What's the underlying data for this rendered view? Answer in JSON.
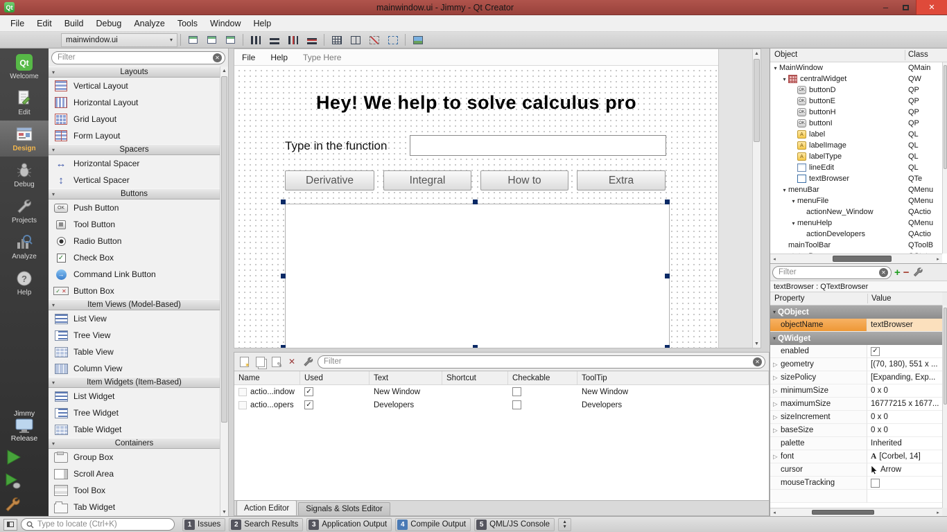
{
  "colors": {
    "titlebar": "#a2453f",
    "close_button": "#df4a3a",
    "selection_orange": "#ee9835",
    "run_green": "#47a33b",
    "accent_blue": "#3a6ea5",
    "handle_navy": "#0a2a66"
  },
  "titlebar": {
    "title": "mainwindow.ui - Jimmy - Qt Creator",
    "app_logo": "Qt"
  },
  "menubar": {
    "items": [
      "File",
      "Edit",
      "Build",
      "Debug",
      "Analyze",
      "Tools",
      "Window",
      "Help"
    ]
  },
  "toolbar": {
    "document": "mainwindow.ui"
  },
  "modebar": {
    "modes": [
      {
        "label": "Welcome"
      },
      {
        "label": "Edit"
      },
      {
        "label": "Design"
      },
      {
        "label": "Debug"
      },
      {
        "label": "Projects"
      },
      {
        "label": "Analyze"
      },
      {
        "label": "Help"
      }
    ],
    "kit": "Jimmy",
    "build_config": "Release"
  },
  "widget_box": {
    "filter_placeholder": "Filter",
    "categories": [
      {
        "name": "Layouts",
        "items": [
          "Vertical Layout",
          "Horizontal Layout",
          "Grid Layout",
          "Form Layout"
        ]
      },
      {
        "name": "Spacers",
        "items": [
          "Horizontal Spacer",
          "Vertical Spacer"
        ]
      },
      {
        "name": "Buttons",
        "items": [
          "Push Button",
          "Tool Button",
          "Radio Button",
          "Check Box",
          "Command Link Button",
          "Button Box"
        ]
      },
      {
        "name": "Item Views (Model-Based)",
        "items": [
          "List View",
          "Tree View",
          "Table View",
          "Column View"
        ]
      },
      {
        "name": "Item Widgets (Item-Based)",
        "items": [
          "List Widget",
          "Tree Widget",
          "Table Widget"
        ]
      },
      {
        "name": "Containers",
        "items": [
          "Group Box",
          "Scroll Area",
          "Tool Box",
          "Tab Widget"
        ]
      }
    ]
  },
  "form": {
    "menu_items": [
      "File",
      "Help",
      "Type Here"
    ],
    "title": "Hey! We help to solve calculus pro",
    "prompt": "Type in the function",
    "buttons": [
      "Derivative",
      "Integral",
      "How to",
      "Extra"
    ]
  },
  "action_editor": {
    "filter_placeholder": "Filter",
    "columns": [
      "Name",
      "Used",
      "Text",
      "Shortcut",
      "Checkable",
      "ToolTip"
    ],
    "rows": [
      {
        "name": "actio...indow",
        "text": "New Window",
        "tooltip": "New Window"
      },
      {
        "name": "actio...opers",
        "text": "Developers",
        "tooltip": "Developers"
      }
    ],
    "tabs": [
      "Action Editor",
      "Signals & Slots Editor"
    ]
  },
  "object_inspector": {
    "columns": [
      "Object",
      "Class"
    ],
    "rows": [
      {
        "object": "MainWindow",
        "class": "QMain"
      },
      {
        "object": "centralWidget",
        "class": "QW"
      },
      {
        "object": "buttonD",
        "class": "QP"
      },
      {
        "object": "buttonE",
        "class": "QP"
      },
      {
        "object": "buttonH",
        "class": "QP"
      },
      {
        "object": "buttonI",
        "class": "QP"
      },
      {
        "object": "label",
        "class": "QL"
      },
      {
        "object": "labelImage",
        "class": "QL"
      },
      {
        "object": "labelType",
        "class": "QL"
      },
      {
        "object": "lineEdit",
        "class": "QL"
      },
      {
        "object": "textBrowser",
        "class": "QTe"
      },
      {
        "object": "menuBar",
        "class": "QMenu"
      },
      {
        "object": "menuFile",
        "class": "QMenu"
      },
      {
        "object": "actionNew_Window",
        "class": "QActio"
      },
      {
        "object": "menuHelp",
        "class": "QMenu"
      },
      {
        "object": "actionDevelopers",
        "class": "QActio"
      },
      {
        "object": "mainToolBar",
        "class": "QToolB"
      },
      {
        "object": "statusBar",
        "class": "QStatu"
      }
    ]
  },
  "property_editor": {
    "filter_placeholder": "Filter",
    "selection": "textBrowser : QTextBrowser",
    "columns": [
      "Property",
      "Value"
    ],
    "font_badge": "A",
    "rows": [
      {
        "name": "QObject",
        "value": ""
      },
      {
        "name": "objectName",
        "value": "textBrowser"
      },
      {
        "name": "QWidget",
        "value": ""
      },
      {
        "name": "enabled",
        "value": ""
      },
      {
        "name": "geometry",
        "value": "[(70, 180), 551 x ..."
      },
      {
        "name": "sizePolicy",
        "value": "[Expanding, Exp..."
      },
      {
        "name": "minimumSize",
        "value": "0 x 0"
      },
      {
        "name": "maximumSize",
        "value": "16777215 x 1677..."
      },
      {
        "name": "sizeIncrement",
        "value": "0 x 0"
      },
      {
        "name": "baseSize",
        "value": "0 x 0"
      },
      {
        "name": "palette",
        "value": "Inherited"
      },
      {
        "name": "font",
        "value": "[Corbel, 14]"
      },
      {
        "name": "cursor",
        "value": "Arrow"
      },
      {
        "name": "mouseTracking",
        "value": ""
      }
    ]
  },
  "statusbar": {
    "locator_placeholder": "Type to locate (Ctrl+K)",
    "panes": [
      {
        "num": "1",
        "label": "Issues"
      },
      {
        "num": "2",
        "label": "Search Results"
      },
      {
        "num": "3",
        "label": "Application Output"
      },
      {
        "num": "4",
        "label": "Compile Output"
      },
      {
        "num": "5",
        "label": "QML/JS Console"
      }
    ]
  },
  "glyphs": {
    "check": "✓",
    "expanded": "▾",
    "collapsed": "▸",
    "expander": "▷",
    "up": "▲",
    "down": "▼",
    "left": "◂",
    "right": "▸",
    "close": "✕",
    "minimize": "–",
    "clear": "✕",
    "combo": "▾"
  }
}
